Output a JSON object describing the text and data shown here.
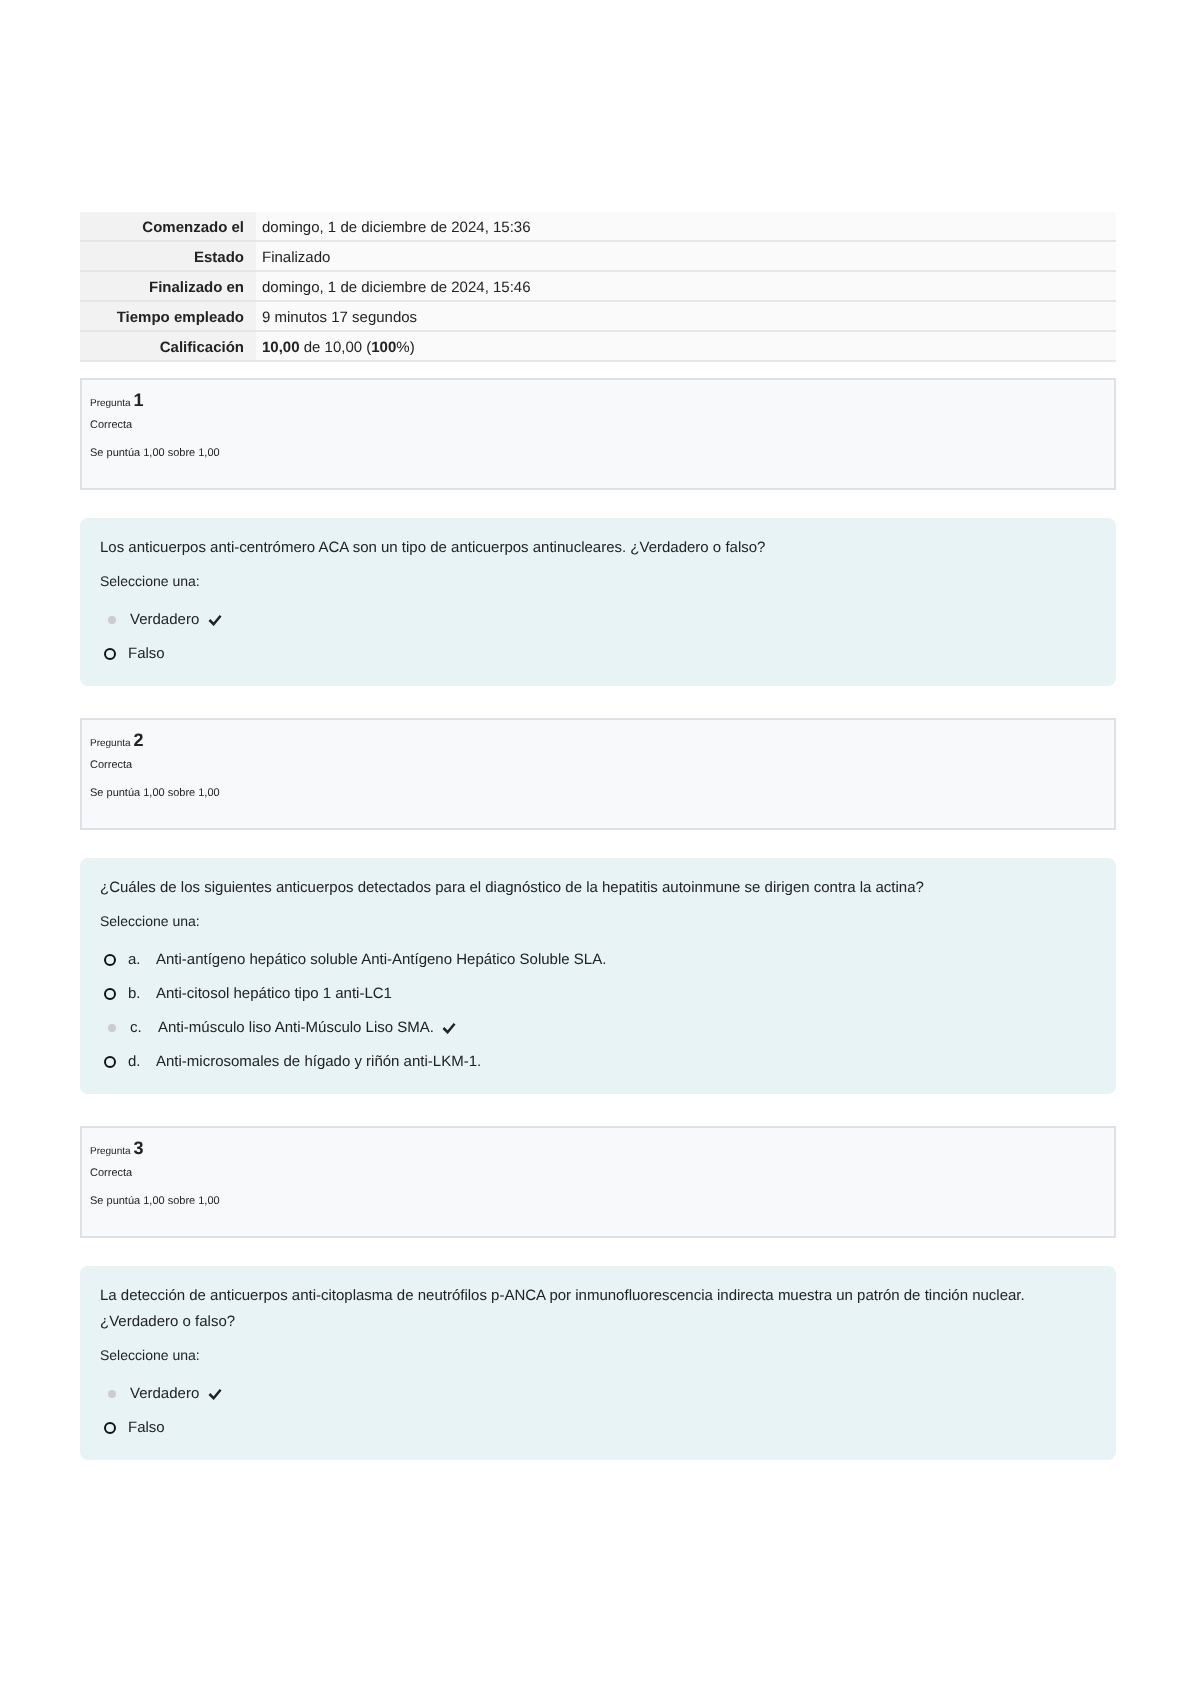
{
  "summary": [
    {
      "label": "Comenzado el",
      "value": "domingo, 1 de diciembre de 2024, 15:36"
    },
    {
      "label": "Estado",
      "value": "Finalizado"
    },
    {
      "label": "Finalizado en",
      "value": "domingo, 1 de diciembre de 2024, 15:46"
    },
    {
      "label": "Tiempo empleado",
      "value": "9 minutos 17 segundos"
    },
    {
      "label": "Calificación",
      "value": "**10,00** de 10,00 (**100**%)"
    }
  ],
  "questions": [
    {
      "label": "Pregunta",
      "number": "1",
      "status": "Correcta",
      "score": "Se puntúa 1,00 sobre 1,00",
      "text": "Los anticuerpos anti-centrómero ACA son un tipo de anticuerpos antinucleares. ¿Verdadero o falso?",
      "prompt": "Seleccione una:",
      "options": [
        {
          "text": "Verdadero",
          "selected": true,
          "correct": true
        },
        {
          "text": "Falso",
          "selected": false,
          "correct": false
        }
      ]
    },
    {
      "label": "Pregunta",
      "number": "2",
      "status": "Correcta",
      "score": "Se puntúa 1,00 sobre 1,00",
      "text": "¿Cuáles de los siguientes anticuerpos detectados para el diagnóstico de la hepatitis autoinmune se dirigen contra la actina?",
      "prompt": "Seleccione una:",
      "options": [
        {
          "letter": "a.",
          "text": "Anti-antígeno hepático soluble Anti-Antígeno Hepático Soluble SLA.",
          "selected": false,
          "correct": false
        },
        {
          "letter": "b.",
          "text": "Anti-citosol hepático tipo 1 anti-LC1",
          "selected": false,
          "correct": false
        },
        {
          "letter": "c.",
          "text": "Anti-músculo liso Anti-Músculo Liso SMA.",
          "selected": true,
          "correct": true
        },
        {
          "letter": "d.",
          "text": "Anti-microsomales de hígado y riñón anti-LKM-1.",
          "selected": false,
          "correct": false
        }
      ]
    },
    {
      "label": "Pregunta",
      "number": "3",
      "status": "Correcta",
      "score": "Se puntúa 1,00 sobre 1,00",
      "text": "La detección de anticuerpos anti-citoplasma de neutrófilos p-ANCA por inmunofluorescencia indirecta muestra un patrón de tinción nuclear. ¿Verdadero o falso?",
      "prompt": "Seleccione una:",
      "options": [
        {
          "text": "Verdadero",
          "selected": true,
          "correct": true
        },
        {
          "text": "Falso",
          "selected": false,
          "correct": false
        }
      ]
    }
  ]
}
